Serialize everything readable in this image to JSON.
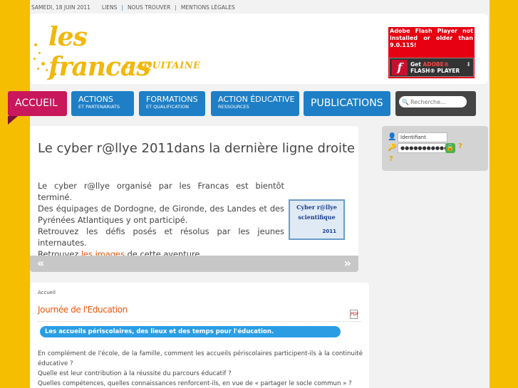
{
  "topbar": {
    "date": "SAMEDI, 18 JUIN 2011",
    "links": [
      "LIENS",
      "NOUS TROUVER",
      "MENTIONS LÉGALES"
    ],
    "separator": "|"
  },
  "logo": {
    "text": "les francas",
    "subtitle": "D'AQUITAINE",
    "color": "#f1b70a"
  },
  "flash": {
    "message": "Adobe Flash Player not installed or older than 9.0.115!",
    "badge_top_prefix": "Get ",
    "badge_top_brand": "ADOBE®",
    "badge_bottom": "FLASH® PLAYER",
    "icon": "flash-f-icon"
  },
  "nav": {
    "items": [
      {
        "main": "ACCUEIL",
        "sub": ""
      },
      {
        "main": "ACTIONS",
        "sub": "ET PARTENARIATS"
      },
      {
        "main": "FORMATIONS",
        "sub": "ET QUALIFICATION"
      },
      {
        "main": "ACTION ÉDUCATIVE",
        "sub": "RESSOURCES"
      },
      {
        "main": "PUBLICATIONS",
        "sub": ""
      }
    ],
    "search_placeholder": "Recherche...",
    "active_color": "#c8175a",
    "accent_color": "#1e7fc6"
  },
  "featured": {
    "title": "Le cyber r@llye 2011dans la dernière ligne droite",
    "lines": [
      "Le cyber r@llye organisé par les Francas est bientôt terminé.",
      "Des équipages de Dordogne, de Gironde, des Landes et des Pyrénées Atlantiques y ont participé.",
      "Retrouvez les défis posés et résolus par les jeunes internautes."
    ],
    "last_line_before": "Retrouvez ",
    "last_line_link": "les images",
    "last_line_after": " de cette aventure.",
    "image_lines": [
      "Cyber r@llye",
      "scientifique",
      "2011"
    ],
    "prev": "«",
    "next": "»"
  },
  "login": {
    "username": "Identifiant",
    "password": "●●●●●●●●●●●●",
    "icons": [
      "user-icon",
      "key-icon",
      "lock-icon",
      "help-icon",
      "register-icon"
    ]
  },
  "article": {
    "breadcrumb": "Accueil",
    "title": "Journée de l'Education",
    "highlight": "Les accueils périscolaires, des lieux et des temps pour l'éducation.",
    "paragraphs": [
      "En complément de l'école, de la famille, comment les accueils périscolaires participent-ils à la continuité éducative ?",
      "Quelle est leur contribution à la réussite du parcours éducatif ?",
      "Quelles compétences, quelles connaissances renforcent-ils, en vue de « partager le socle commun » ?"
    ],
    "pdf_label": "PDF"
  }
}
